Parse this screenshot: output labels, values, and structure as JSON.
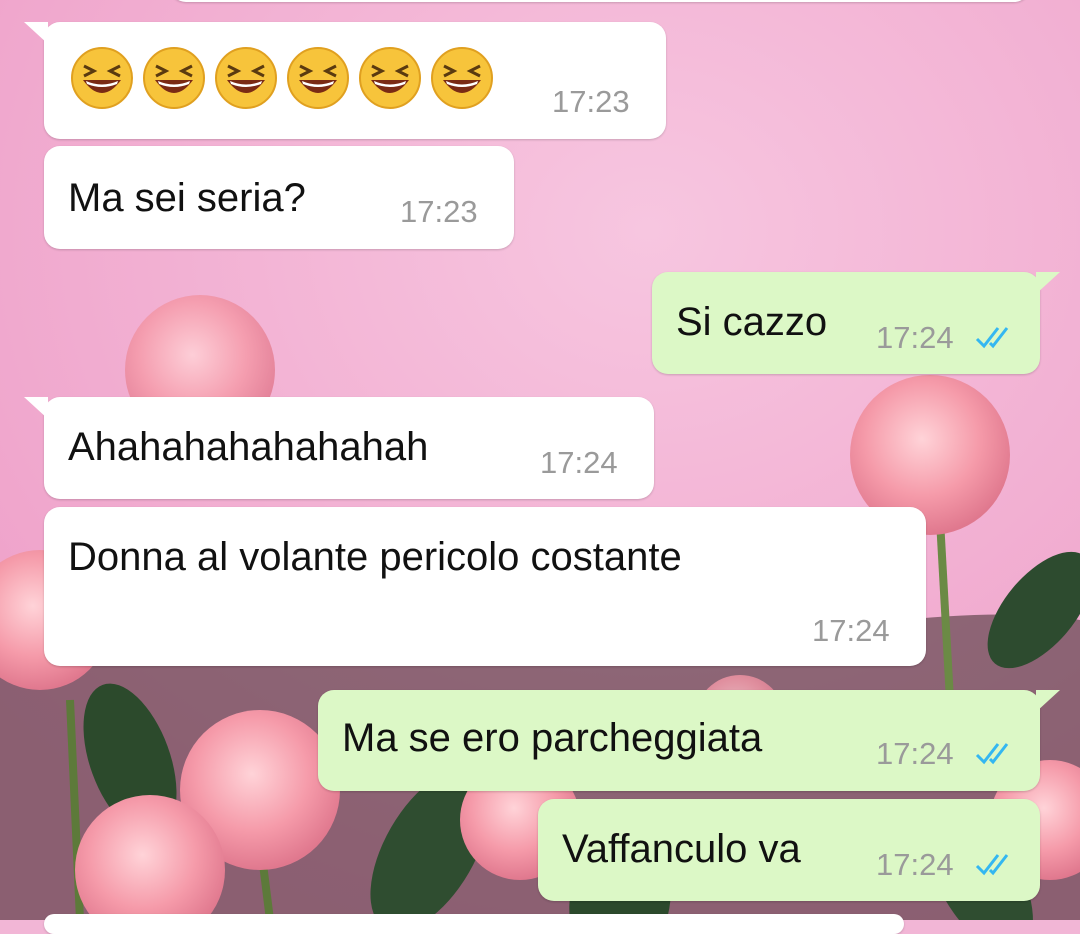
{
  "messages": [
    {
      "id": "m1",
      "direction": "in",
      "text": "",
      "emoji": [
        "laughing-face",
        "laughing-face",
        "laughing-face",
        "laughing-face",
        "laughing-face",
        "laughing-face"
      ],
      "time": "17:23"
    },
    {
      "id": "m2",
      "direction": "in",
      "text": "Ma sei seria?",
      "time": "17:23"
    },
    {
      "id": "m3",
      "direction": "out",
      "text": "Si cazzo",
      "time": "17:24",
      "status": "read"
    },
    {
      "id": "m4",
      "direction": "in",
      "text": "Ahahahahahahahah",
      "time": "17:24"
    },
    {
      "id": "m5",
      "direction": "in",
      "text": "Donna al volante pericolo costante",
      "time": "17:24"
    },
    {
      "id": "m6",
      "direction": "out",
      "text": "Ma se ero parcheggiata",
      "time": "17:24",
      "status": "read"
    },
    {
      "id": "m7",
      "direction": "out",
      "text": "Vaffanculo va",
      "time": "17:24",
      "status": "read"
    }
  ],
  "colors": {
    "incoming_bubble": "#ffffff",
    "outgoing_bubble": "#dcf8c6",
    "timestamp": "#9a9a9a",
    "read_ticks": "#34b7f1",
    "wallpaper": "#f2b6d6"
  }
}
